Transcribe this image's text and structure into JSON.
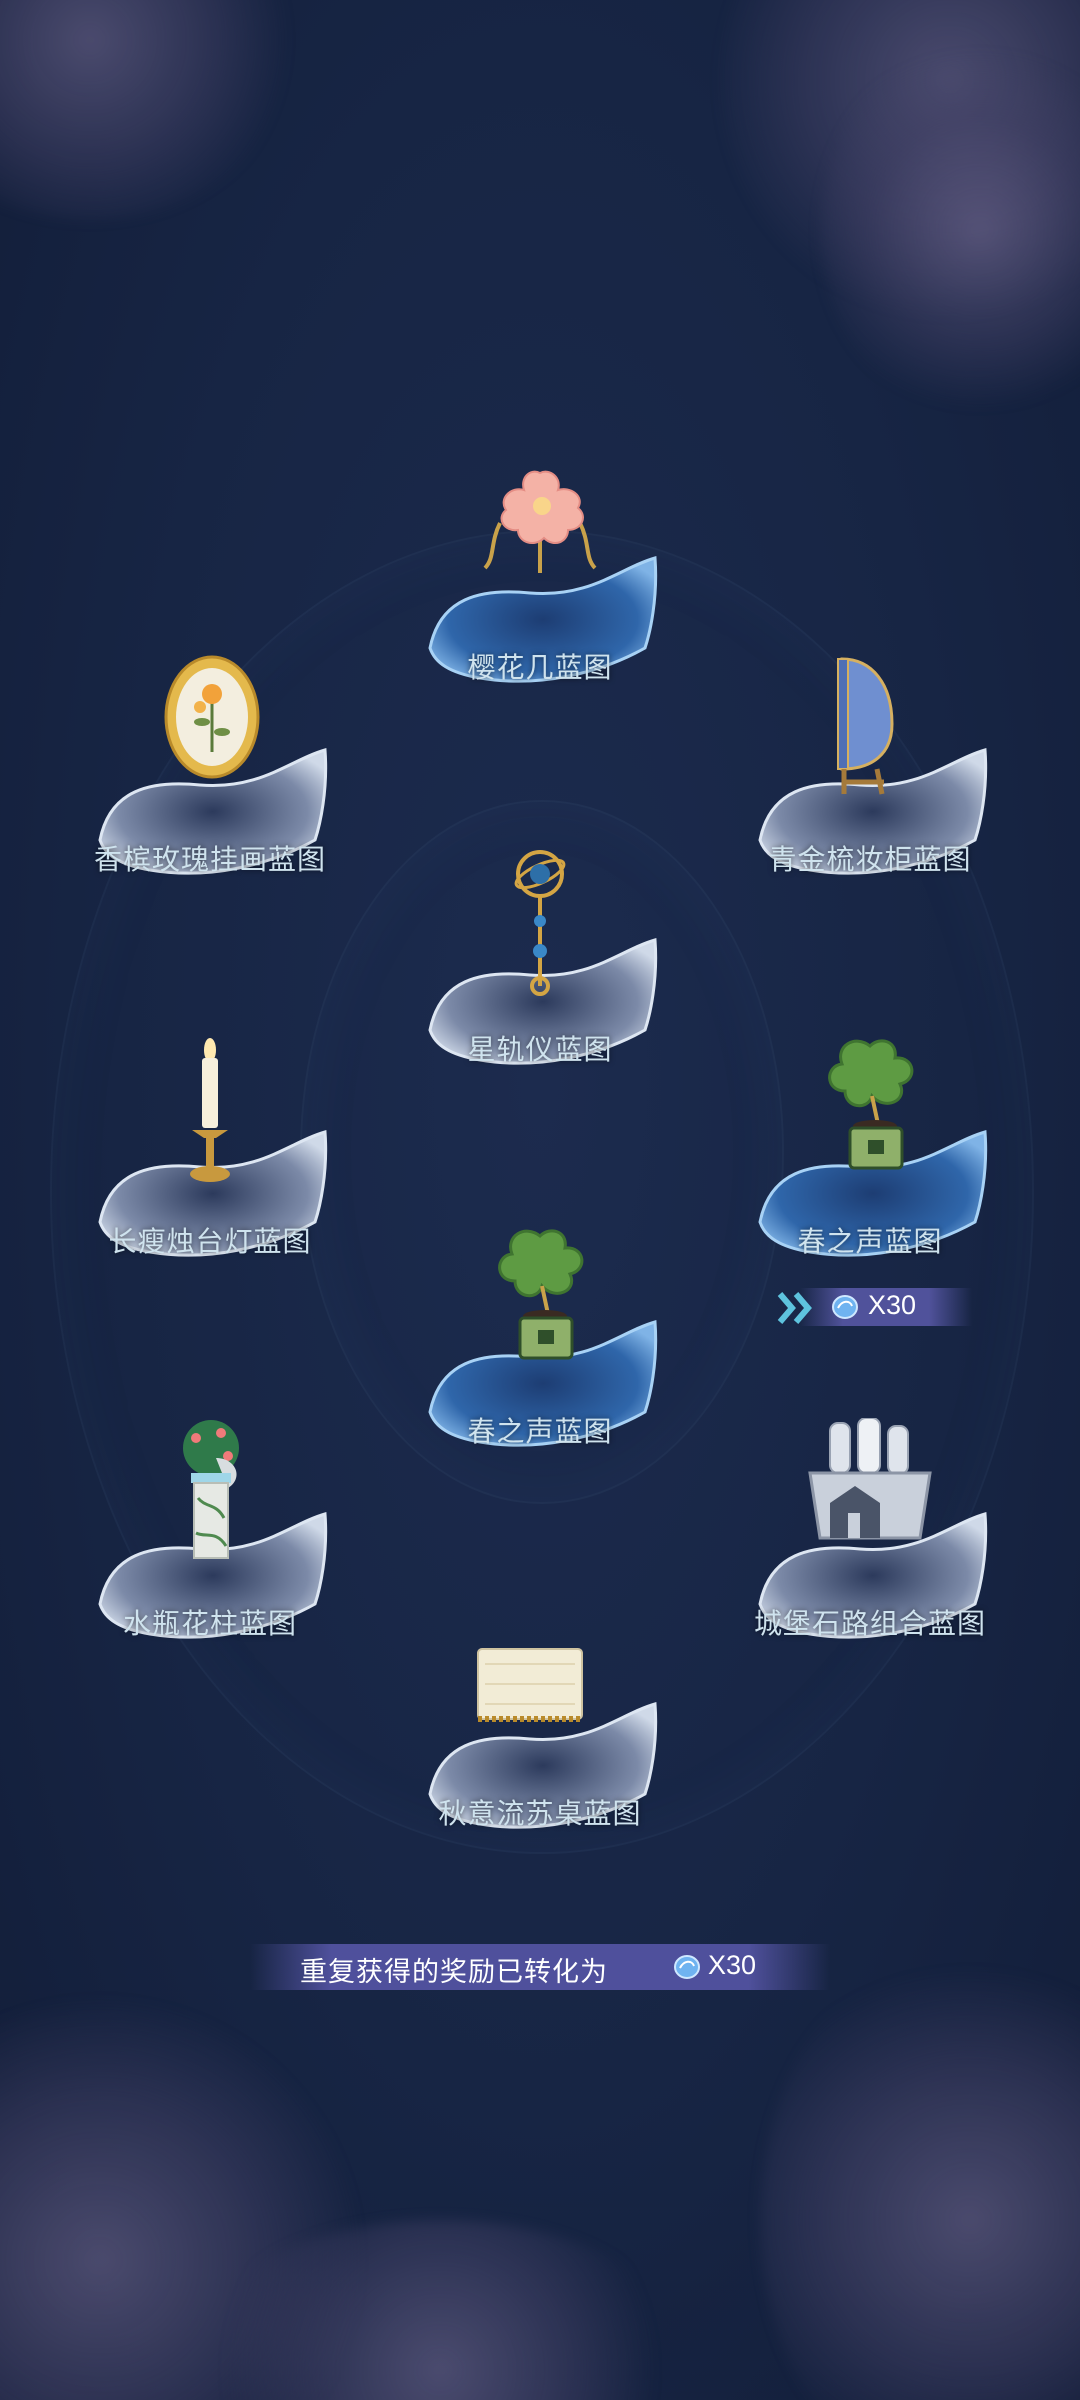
{
  "rewards": [
    {
      "label": "樱花几蓝图",
      "highlight": true
    },
    {
      "label": "香槟玫瑰挂画蓝图",
      "highlight": false
    },
    {
      "label": "青金梳妆柜蓝图",
      "highlight": false
    },
    {
      "label": "星轨仪蓝图",
      "highlight": false
    },
    {
      "label": "长瘦烛台灯蓝图",
      "highlight": false
    },
    {
      "label": "春之声蓝图",
      "highlight": true,
      "converted_count": "X30"
    },
    {
      "label": "春之声蓝图",
      "highlight": true
    },
    {
      "label": "水瓶花柱蓝图",
      "highlight": false
    },
    {
      "label": "城堡石路组合蓝图",
      "highlight": false
    },
    {
      "label": "秋意流苏桌蓝图",
      "highlight": false
    }
  ],
  "notice": {
    "text": "重复获得的奖励已转化为",
    "count": "X30",
    "currency_icon": "blue-gem-icon"
  },
  "colors": {
    "background": "#172544",
    "label": "#cfe3ee",
    "pad_highlight": "#3f7ec4",
    "pad_normal": "#b9c6d8",
    "banner": "#5555a5"
  }
}
